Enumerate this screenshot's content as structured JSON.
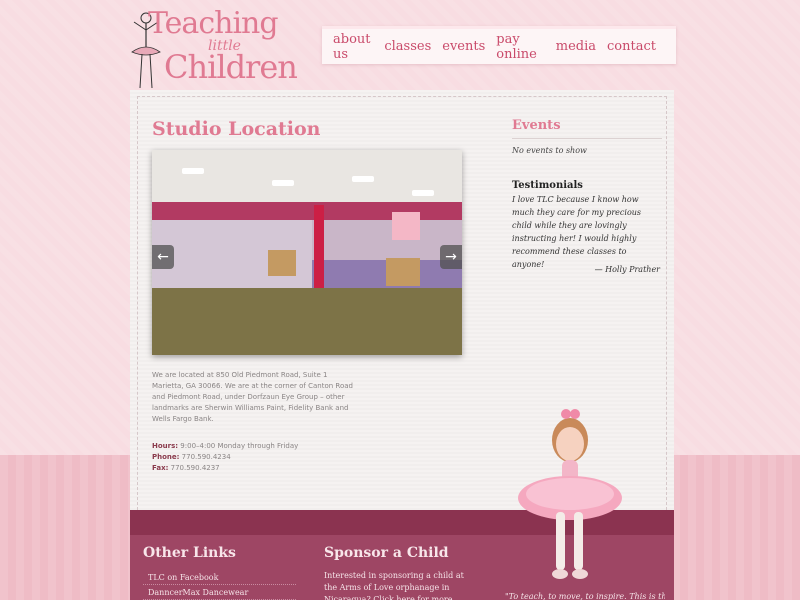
{
  "logo": {
    "line1": "Teaching",
    "line2": "little",
    "line3": "Children"
  },
  "nav": {
    "items": [
      {
        "label": "about us"
      },
      {
        "label": "classes"
      },
      {
        "label": "events"
      },
      {
        "label": "pay online"
      },
      {
        "label": "media"
      },
      {
        "label": "contact"
      }
    ]
  },
  "main": {
    "title": "Studio Location",
    "slideshow": {
      "prev_icon": "←",
      "next_icon": "→"
    },
    "address": "We are located at 850 Old Piedmont Road, Suite 1 Marietta, GA 30066. We are at the corner of Canton Road and Piedmont Road, under Dorfzaun Eye Group – other landmarks are Sherwin Williams Paint, Fidelity Bank and Wells Fargo Bank.",
    "hours_label": "Hours:",
    "hours_value": " 9:00–4:00 Monday through Friday",
    "phone_label": "Phone:",
    "phone_value": " 770.590.4234",
    "fax_label": "Fax:",
    "fax_value": " 770.590.4237"
  },
  "sidebar": {
    "events_title": "Events",
    "events_empty": "No events to show",
    "testimonials_title": "Testimonials",
    "testimonial_text": "I love TLC because I know how much they care for my precious child while they are lovingly instructing her! I would highly recommend these classes to anyone!",
    "testimonial_author": "— Holly Prather"
  },
  "footer": {
    "links_title": "Other Links",
    "links": [
      {
        "label": "TLC on Facebook"
      },
      {
        "label": "DanncerMax Dancewear"
      }
    ],
    "sponsor_title": "Sponsor a Child",
    "sponsor_text": "Interested in sponsoring a child at the Arms of Love orphanage in Nicaragua? Click here for more information!",
    "quote": "\"To teach, to move, to inspire. This is the"
  },
  "colors": {
    "accent": "#e07a92",
    "nav_text": "#c94a6a",
    "footer_bg": "#8b3350",
    "page_bg": "#f6d6dc"
  }
}
